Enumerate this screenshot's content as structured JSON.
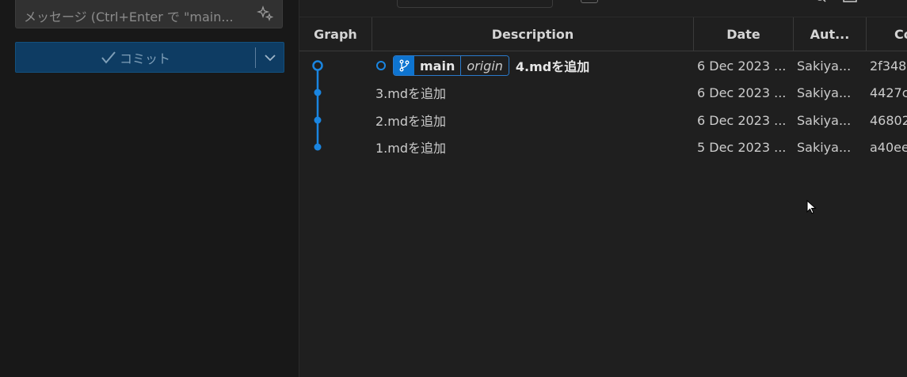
{
  "scm": {
    "message_placeholder": "メッセージ (Ctrl+Enter で \"main...",
    "commit_label": "コミット"
  },
  "graph": {
    "columns": {
      "graph": "Graph",
      "description": "Description",
      "date": "Date",
      "author": "Aut...",
      "commit": "Co"
    },
    "head": {
      "branch": "main",
      "remote": "origin"
    },
    "rows": [
      {
        "description": "4.mdを追加",
        "date": "6 Dec 2023 ...",
        "author": "Sakiya...",
        "hash": "2f348"
      },
      {
        "description": "3.mdを追加",
        "date": "6 Dec 2023 ...",
        "author": "Sakiya...",
        "hash": "4427c"
      },
      {
        "description": "2.mdを追加",
        "date": "6 Dec 2023 ...",
        "author": "Sakiya...",
        "hash": "46802"
      },
      {
        "description": "1.mdを追加",
        "date": "5 Dec 2023 ...",
        "author": "Sakiya...",
        "hash": "a40ee"
      }
    ]
  },
  "colors": {
    "graph_line": "#1a85e0",
    "commit_button_bg": "#0e3c63",
    "ref_accent": "#0e74d0"
  }
}
